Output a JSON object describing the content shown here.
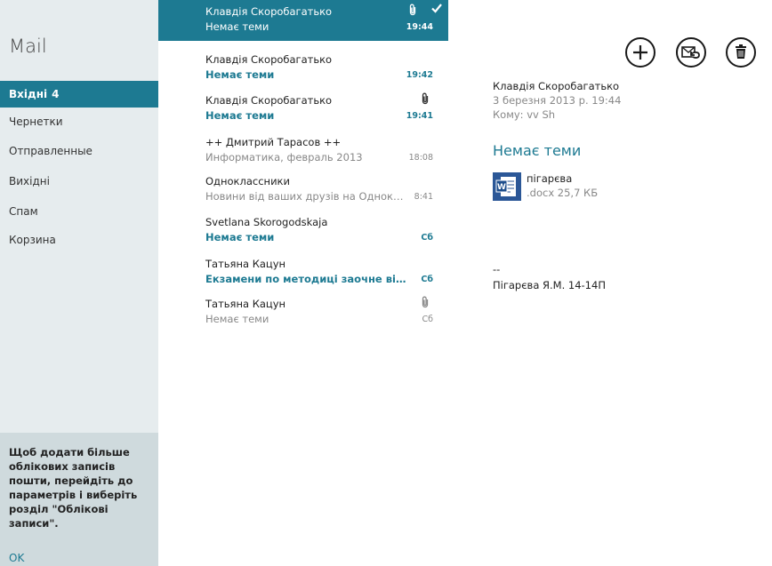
{
  "sidebar": {
    "title": "Mail",
    "folders": [
      {
        "label": "Вхідні",
        "count": "4"
      },
      {
        "label": "Чернетки"
      },
      {
        "label": "Отправленные"
      },
      {
        "label": "Вихідні"
      },
      {
        "label": "Спам"
      },
      {
        "label": "Корзина"
      }
    ],
    "note": {
      "text": "Щоб додати більше облікових записів пошти, перейдіть до параметрів і виберіть розділ \"Облікові записи\".",
      "ok_label": "OK"
    }
  },
  "messages": [
    {
      "sender": "Клавдія Скоробагатько",
      "subject": "Немає теми",
      "time": "19:44",
      "attachment": true,
      "selected": true,
      "checked": true
    },
    {
      "sender": "Клавдія Скоробагатько",
      "subject": "Немає теми",
      "time": "19:42",
      "unread": true
    },
    {
      "sender": "Клавдія Скоробагатько",
      "subject": "Немає теми",
      "time": "19:41",
      "unread": true,
      "attachment": true
    },
    {
      "sender": "++ Дмитрий Тарасов ++",
      "subject": "Информатика, февраль 2013",
      "time": "18:08"
    },
    {
      "sender": "Одноклассники",
      "subject": "Новини від ваших друзів на Однокла...",
      "time": "8:41"
    },
    {
      "sender": "Svetlana Skorogodskaja",
      "subject": "Немає теми",
      "time": "Сб",
      "unread": true
    },
    {
      "sender": "Татьяна Кацун",
      "subject": "Екзамени по методиці заочне відді...",
      "time": "Сб",
      "unread": true
    },
    {
      "sender": "Татьяна Кацун",
      "subject": "Немає теми",
      "time": "Сб",
      "attachment": true
    }
  ],
  "reader": {
    "from": "Клавдія Скоробагатько",
    "date": "3 березня 2013 р.  19:44",
    "to": "Кому: vv Sh",
    "subject": "Немає теми",
    "attachment": {
      "name": "пігарєва",
      "meta": ".docx 25,7 КБ",
      "icon": "word-document-icon"
    },
    "signature_sep": "--",
    "signature": "Пігарєва  Я.М. 14-14П"
  },
  "toolbar": {
    "icons": [
      "new-mail-icon",
      "reply-icon",
      "delete-icon"
    ]
  },
  "colors": {
    "accent": "#1d7a92",
    "sidebar_bg": "#e6ecee",
    "note_bg": "#cfdadd",
    "word_blue": "#2b5797"
  }
}
